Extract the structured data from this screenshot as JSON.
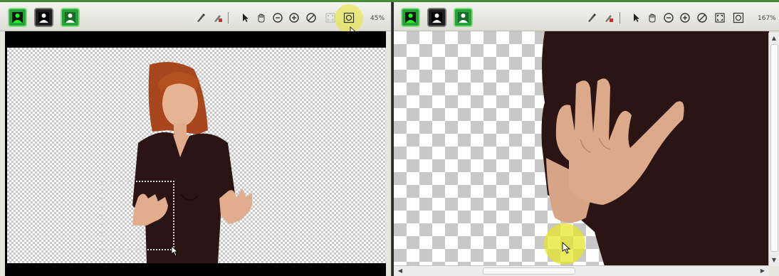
{
  "left_panel": {
    "zoom": "45%",
    "mode_buttons": [
      "matte-view-icon",
      "foreground-view-icon",
      "composite-view-icon"
    ],
    "tools": [
      "paint-brush-icon",
      "eraser-brush-icon",
      "arrow-select-icon",
      "hand-pan-icon",
      "zoom-out-icon",
      "zoom-in-icon",
      "no-zoom-icon",
      "fit-icon",
      "zoom-region-icon"
    ]
  },
  "right_panel": {
    "zoom": "167%",
    "mode_buttons": [
      "matte-view-icon",
      "foreground-view-icon",
      "composite-view-icon"
    ],
    "tools": [
      "paint-brush-icon",
      "eraser-brush-icon",
      "arrow-select-icon",
      "hand-pan-icon",
      "zoom-out-icon",
      "zoom-in-icon",
      "no-zoom-icon",
      "fit-icon",
      "zoom-region-icon"
    ]
  },
  "colors": {
    "active_green": "#25a33a",
    "highlight_yellow": "#e6e628",
    "shirt": "#2b1414"
  }
}
